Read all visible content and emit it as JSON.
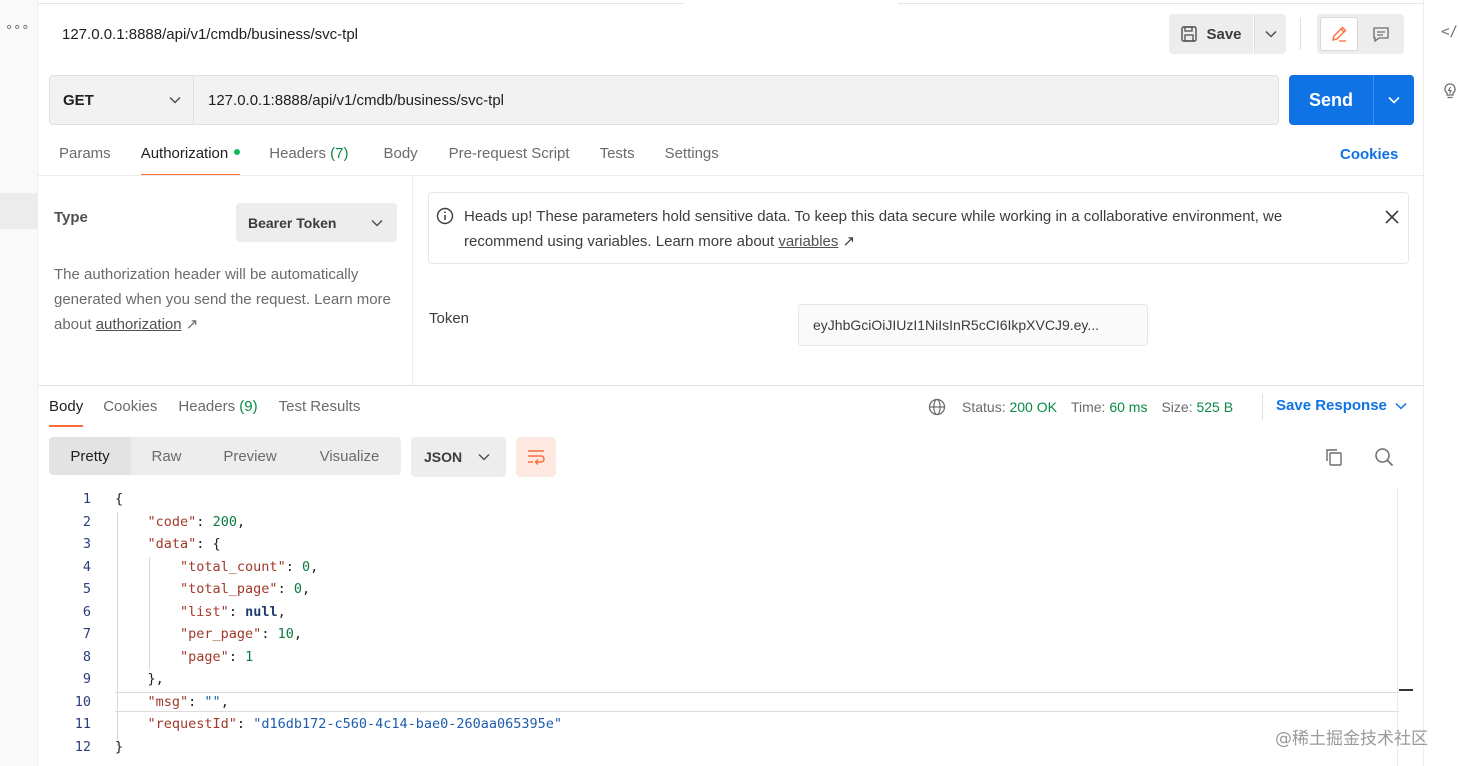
{
  "header": {
    "title": "127.0.0.1:8888/api/v1/cmdb/business/svc-tpl",
    "save_label": "Save",
    "icons": {
      "save": "save-icon",
      "edit": "pencil-icon",
      "comment": "comment-icon"
    }
  },
  "request": {
    "method": "GET",
    "url": "127.0.0.1:8888/api/v1/cmdb/business/svc-tpl",
    "send_label": "Send"
  },
  "request_tabs": {
    "params": "Params",
    "authorization": "Authorization",
    "headers": "Headers",
    "headers_count": "(7)",
    "body": "Body",
    "prerequest": "Pre-request Script",
    "tests": "Tests",
    "settings": "Settings",
    "cookies": "Cookies"
  },
  "auth": {
    "type_label": "Type",
    "type_value": "Bearer Token",
    "description_1": "The authorization header will be automatically generated when you send the request. Learn more about ",
    "description_link": "authorization",
    "alert_text_1": "Heads up! These parameters hold sensitive data. To keep this data secure while working in a collaborative environment, we recommend using variables. Learn more about ",
    "alert_link": "variables",
    "token_label": "Token",
    "token_value": "eyJhbGciOiJIUzI1NiIsInR5cCI6IkpXVCJ9.ey..."
  },
  "response_tabs": {
    "body": "Body",
    "cookies": "Cookies",
    "headers": "Headers",
    "headers_count": "(9)",
    "test_results": "Test Results"
  },
  "status": {
    "status_label": "Status:",
    "status_value": "200 OK",
    "time_label": "Time:",
    "time_value": "60 ms",
    "size_label": "Size:",
    "size_value": "525 B",
    "save_response": "Save Response"
  },
  "view": {
    "pretty": "Pretty",
    "raw": "Raw",
    "preview": "Preview",
    "visualize": "Visualize",
    "format": "JSON"
  },
  "code": {
    "line_numbers": [
      "1",
      "2",
      "3",
      "4",
      "5",
      "6",
      "7",
      "8",
      "9",
      "10",
      "11",
      "12"
    ],
    "code_key": "\"code\"",
    "code_val": "200",
    "data_key": "\"data\"",
    "total_count_key": "\"total_count\"",
    "total_count_val": "0",
    "total_page_key": "\"total_page\"",
    "total_page_val": "0",
    "list_key": "\"list\"",
    "list_val": "null",
    "per_page_key": "\"per_page\"",
    "per_page_val": "10",
    "page_key": "\"page\"",
    "page_val": "1",
    "msg_key": "\"msg\"",
    "msg_val": "\"\"",
    "request_id_key": "\"requestId\"",
    "request_id_val": "\"d16db172-c560-4c14-bae0-260aa065395e\""
  },
  "watermark": "@稀土掘金技术社区",
  "colors": {
    "accent": "#ff6c37",
    "primary": "#0f73e6",
    "success": "#0a8a45"
  }
}
